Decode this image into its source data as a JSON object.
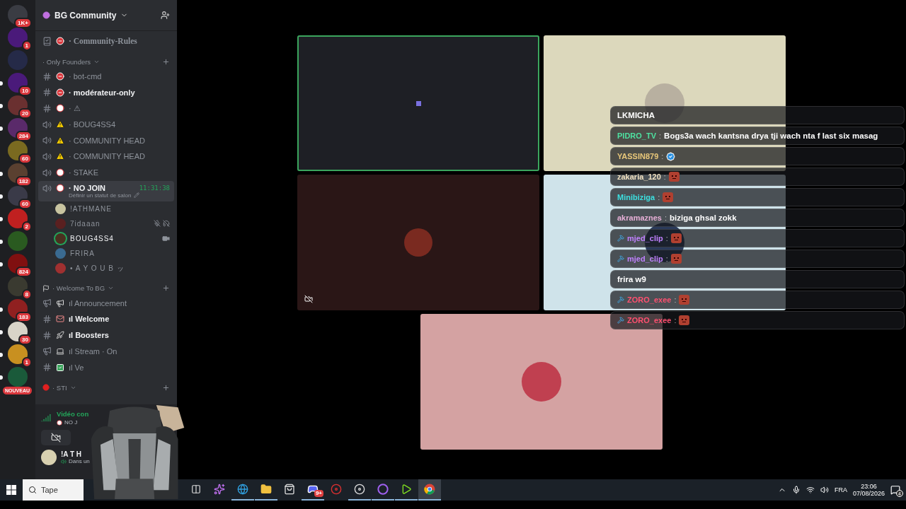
{
  "servers": [
    {
      "color": "#3a3c43",
      "badge": "1K+",
      "unread": false
    },
    {
      "color": "#4a1a7a",
      "badge": "1",
      "unread": false
    },
    {
      "color": "#252a48",
      "unread": false
    },
    {
      "color": "#4a1a7a",
      "badge": "10",
      "unread": true
    },
    {
      "color": "#6a3030",
      "badge": "20",
      "unread": true
    },
    {
      "color": "#5a2a6a",
      "badge": "284",
      "unread": true
    },
    {
      "color": "#7a6a20",
      "badge": "60",
      "unread": false
    },
    {
      "color": "#5a4030",
      "badge": "182",
      "unread": true
    },
    {
      "color": "#3a3a48",
      "badge": "60",
      "unread": true
    },
    {
      "color": "#c02020",
      "badge": "2",
      "unread": true
    },
    {
      "color": "#2a5a20",
      "unread": true
    },
    {
      "color": "#801010",
      "badge": "824",
      "unread": true
    },
    {
      "color": "#3a3a30",
      "badge": "8",
      "unread": false
    },
    {
      "color": "#902020",
      "badge": "183",
      "unread": true
    },
    {
      "color": "#d8d4c8",
      "badge": "30",
      "unread": true
    },
    {
      "color": "#c89020",
      "badge": "1",
      "unread": true
    },
    {
      "color": "#1a5a3a",
      "unread": true
    }
  ],
  "new_badge": "NOUVEAU",
  "server_name": "BG Community",
  "sidebar": [
    {
      "kind": "rules",
      "emoji": {
        "kind": "no-entry"
      },
      "name": "· Community-Rules",
      "unread": false,
      "selected": false
    },
    {
      "kind": "category",
      "name": "· Only Founders"
    },
    {
      "kind": "text",
      "emoji": {
        "kind": "no-entry"
      },
      "name": "· bot-cmd",
      "unread": false,
      "selected": false
    },
    {
      "kind": "text",
      "emoji": {
        "kind": "no-entry"
      },
      "name": "· modérateur-only",
      "unread": true,
      "selected": false
    },
    {
      "kind": "text",
      "emoji": {
        "kind": "forbidden"
      },
      "name": "· ⚠",
      "unread": false,
      "selected": false
    },
    {
      "kind": "voice",
      "emoji": {
        "kind": "warning"
      },
      "name": "· BOUG4SS4",
      "unread": false,
      "selected": false
    },
    {
      "kind": "voice",
      "emoji": {
        "kind": "warning"
      },
      "name": "· COMMUNITY HEAD",
      "unread": false,
      "selected": false
    },
    {
      "kind": "voice",
      "emoji": {
        "kind": "warning"
      },
      "name": "· COMMUNITY HEAD",
      "unread": false,
      "selected": false
    },
    {
      "kind": "voice",
      "emoji": {
        "kind": "forbidden"
      },
      "name": "· STAKE",
      "unread": false,
      "selected": false
    },
    {
      "kind": "voice",
      "emoji": {
        "kind": "forbidden"
      },
      "name": "· NO JOIN",
      "unread": true,
      "selected": true,
      "timer": "11:31:38",
      "status": "Définir un statut de salon",
      "children": [
        {
          "name": "!ATHMANE",
          "color": "#c8c4a0",
          "speaking": false,
          "muted": false,
          "video": false
        },
        {
          "name": "7idaaan",
          "color": "#5a2020",
          "speaking": false,
          "muted": true,
          "video": false
        },
        {
          "name": "BOUG4SS4",
          "color": "#4a3020",
          "speaking": true,
          "muted": false,
          "video": true
        },
        {
          "name": "FRIRA",
          "color": "#3a6a90",
          "speaking": false,
          "muted": false,
          "video": false
        },
        {
          "name": "• A Y O U B ッ",
          "color": "#a03030",
          "speaking": false,
          "muted": false,
          "video": false
        }
      ]
    },
    {
      "kind": "category",
      "emoji": {
        "kind": "flag"
      },
      "name": "· Welcome To BG"
    },
    {
      "kind": "announce",
      "emoji": {
        "kind": "megaphone"
      },
      "name": "ıl Announcement",
      "unread": false,
      "selected": false
    },
    {
      "kind": "text",
      "emoji": {
        "kind": "mail"
      },
      "name": "ıl Welcome",
      "unread": true,
      "selected": false
    },
    {
      "kind": "text",
      "emoji": {
        "kind": "rocket"
      },
      "name": "ıl Boosters",
      "unread": true,
      "selected": false
    },
    {
      "kind": "announce",
      "emoji": {
        "kind": "laptop"
      },
      "name": "ıl Stream · On",
      "unread": false,
      "selected": false
    },
    {
      "kind": "text",
      "emoji": {
        "kind": "check"
      },
      "name": "ıl Ve",
      "unread": false,
      "selected": false
    },
    {
      "kind": "category",
      "emoji": {
        "kind": "red-dot"
      },
      "name": "· STI"
    }
  ],
  "connection": {
    "title": "Vidéo con",
    "channel": "NO J"
  },
  "user": {
    "name": "!A T H",
    "status": "Dans un"
  },
  "tiles": [
    {
      "kind": "blank",
      "color": "#1e1f25",
      "speaking": true,
      "camera_off": false
    },
    {
      "kind": "avatar",
      "color": "#dcd8bc",
      "speaking": false,
      "camera_off": false
    },
    {
      "kind": "avatar",
      "color": "#2a1616",
      "speaking": false,
      "camera_off": true
    },
    {
      "kind": "avatar",
      "color": "#cfe3ea",
      "speaking": false,
      "camera_off": false
    },
    {
      "kind": "avatar",
      "color": "#d4a2a2",
      "speaking": false,
      "camera_off": false
    }
  ],
  "chat": [
    {
      "message": "LKMICHA"
    },
    {
      "name": "PIDRO_TV",
      "sep": ":",
      "color": "#4ee0a0",
      "mod": false,
      "message": "Bogs3a wach kantsna drya tji wach nta f last six masag"
    },
    {
      "name": "YASSIN879",
      "sep": ":",
      "color": "#e8c77a",
      "mod": false,
      "emoji": {
        "kind": "check"
      }
    },
    {
      "name": "zakaria_120",
      "sep": ":",
      "color": "#f0e0c0",
      "mod": false,
      "emoji": {
        "kind": "face"
      }
    },
    {
      "name": "Minibiziga",
      "sep": ":",
      "color": "#3de0e0",
      "mod": false,
      "emoji": {
        "kind": "face"
      }
    },
    {
      "name": "akramaznes",
      "sep": ":",
      "color": "#e8b0d8",
      "mod": false,
      "message": "biziga ghsal zokk"
    },
    {
      "name": "mjed_clip",
      "sep": ":",
      "color": "#c080ff",
      "mod": true,
      "emoji": {
        "kind": "face"
      }
    },
    {
      "name": "mjed_clip",
      "sep": ":",
      "color": "#c080ff",
      "mod": true,
      "emoji": {
        "kind": "face"
      }
    },
    {
      "message": "frira w9"
    },
    {
      "name": "ZORO_exee",
      "sep": ":",
      "color": "#ff5070",
      "mod": true,
      "emoji": {
        "kind": "face"
      }
    },
    {
      "name": "ZORO_exee",
      "sep": ":",
      "color": "#ff5070",
      "mod": true,
      "emoji": {
        "kind": "face"
      }
    }
  ],
  "taskbar": {
    "search_placeholder": "Tape",
    "apps": [
      {
        "kind": "task-view",
        "running": false,
        "active": false
      },
      {
        "kind": "copilot",
        "running": false,
        "active": false
      },
      {
        "kind": "edge",
        "running": true,
        "active": false
      },
      {
        "kind": "explorer",
        "running": true,
        "active": false
      },
      {
        "kind": "store",
        "running": false,
        "active": false
      },
      {
        "kind": "discord",
        "running": true,
        "active": false,
        "badge": "9+"
      },
      {
        "kind": "red",
        "running": false,
        "active": false
      },
      {
        "kind": "obs",
        "running": true,
        "active": false
      },
      {
        "kind": "ring",
        "running": true,
        "active": false
      },
      {
        "kind": "green",
        "running": true,
        "active": false
      },
      {
        "kind": "chrome",
        "running": true,
        "active": true
      }
    ],
    "language": "FRA",
    "time": "23:06",
    "date": "07/08/2026",
    "notifications": "4"
  }
}
